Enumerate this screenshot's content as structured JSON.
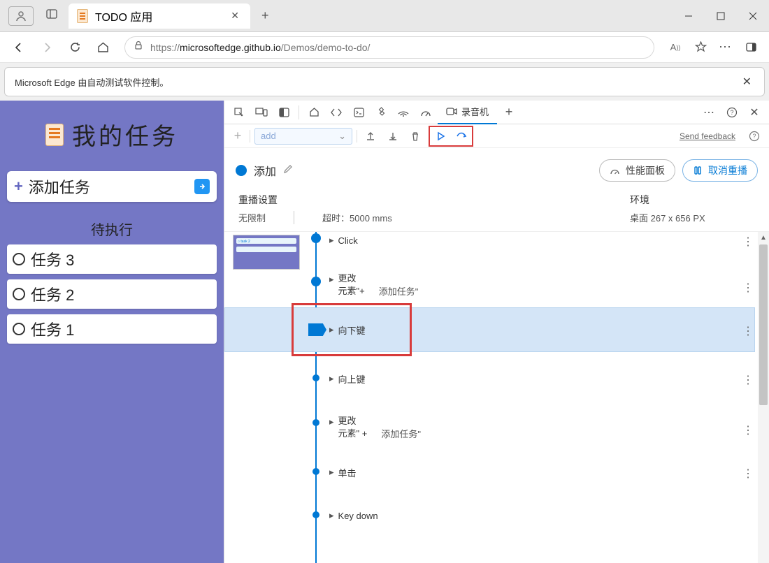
{
  "window": {
    "tab_title": "TODO 应用"
  },
  "urlbar": {
    "url_prefix": "https://",
    "url_host": "microsoftedge.github.io",
    "url_path": "/Demos/demo-to-do/"
  },
  "banner": {
    "text": "Microsoft Edge 由自动测试软件控制。"
  },
  "app": {
    "title": "我的任务",
    "add_label": "添加任务",
    "pending_header": "待执行",
    "tasks": [
      {
        "label": "任务 3"
      },
      {
        "label": "任务 2"
      },
      {
        "label": "任务 1"
      }
    ]
  },
  "devtools": {
    "recorder_tab": "录音机",
    "add_placeholder": "add",
    "feedback": "Send feedback",
    "recording_name": "添加",
    "perf_panel": "性能面板",
    "cancel_replay": "取消重播",
    "replay_settings_label": "重播设置",
    "replay_unlimited": "无限制",
    "timeout_label": "超时：5000 mms",
    "env_label": "环境",
    "env_value": "桌面 267 x 656 PX",
    "steps": {
      "click": "Click",
      "change1_a": "更改",
      "change1_b": "元素\"+",
      "change1_extra": "添加任务\"",
      "keydown": "向下键",
      "keyup": "向上键",
      "change2_a": "更改",
      "change2_b": "元素\" +",
      "change2_extra": "添加任务\"",
      "click2": "单击",
      "keydown2": "Key down"
    }
  }
}
